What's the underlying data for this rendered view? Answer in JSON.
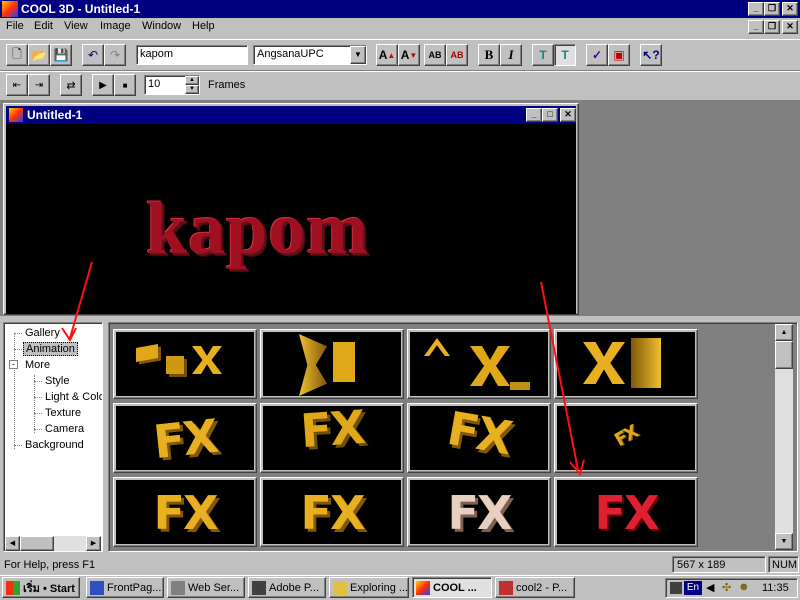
{
  "app_title": "COOL 3D - Untitled-1",
  "menu": [
    "File",
    "Edit",
    "View",
    "Image",
    "Window",
    "Help"
  ],
  "toolbar": {
    "text_value": "kapom",
    "font_value": "AngsanaUPC",
    "frames_value": "10",
    "frames_label": "Frames"
  },
  "doc_window": {
    "title": "Untitled-1",
    "text": "kapom"
  },
  "tree": {
    "gallery": "Gallery",
    "animation": "Animation",
    "more": "More",
    "style": "Style",
    "light_color": "Light & Colo",
    "texture": "Texture",
    "camera": "Camera",
    "background": "Background"
  },
  "thumbnails": {
    "row2": [
      "FX",
      "FX",
      "FX",
      "FX"
    ],
    "row3": [
      "FX",
      "FX",
      "FX",
      "FX"
    ]
  },
  "status": {
    "help": "For Help, press F1",
    "dims": "567 x 189",
    "num": "NUM"
  },
  "taskbar": {
    "start": "เริ่ม • Start",
    "tasks": [
      "FrontPag...",
      "Web Ser...",
      "Adobe P...",
      "Exploring ...",
      "COOL ...",
      "cool2 - P..."
    ],
    "lang": "En",
    "clock": "11:35"
  },
  "colors": {
    "title_blue": "#000080",
    "gold": "#e0a818",
    "red_text": "#a01020",
    "annotation_red": "#ff1010"
  }
}
